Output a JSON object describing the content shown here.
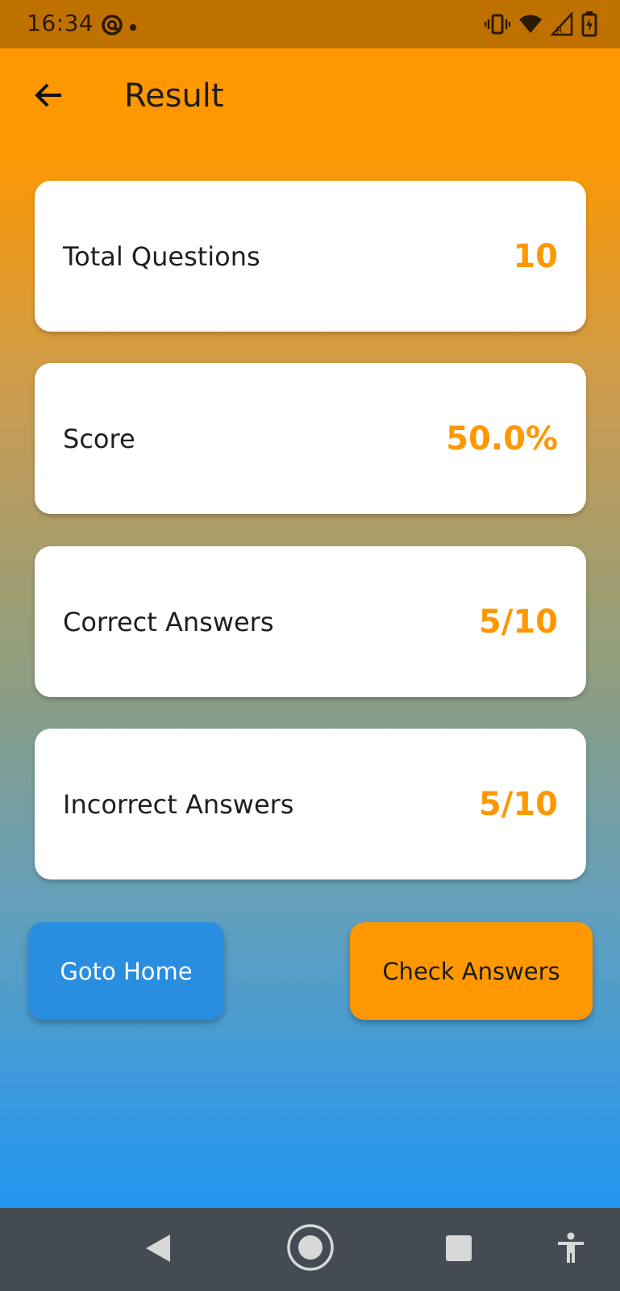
{
  "status_bar": {
    "time": "16:34",
    "left_icons": [
      "sync-at-icon",
      "notification-dot-icon"
    ],
    "right_icons": [
      "vibrate-icon",
      "wifi-icon",
      "signal-roaming-icon",
      "battery-charging-icon"
    ]
  },
  "app_bar": {
    "back_icon": "arrow-left-icon",
    "title": "Result"
  },
  "stats": [
    {
      "label": "Total Questions",
      "value": "10"
    },
    {
      "label": "Score",
      "value": "50.0%"
    },
    {
      "label": "Correct Answers",
      "value": "5/10"
    },
    {
      "label": "Incorrect Answers",
      "value": "5/10"
    }
  ],
  "actions": {
    "home_label": "Goto Home",
    "check_label": "Check Answers"
  },
  "nav_bar": {
    "icons": [
      "back-triangle-icon",
      "home-circle-icon",
      "recents-square-icon",
      "accessibility-icon"
    ]
  },
  "colors": {
    "accent": "#ff9800",
    "status_bar": "#bf7100",
    "home_button": "#2a8ee0",
    "gradient_bottom": "#2196f3",
    "nav_bar": "#454b52"
  }
}
